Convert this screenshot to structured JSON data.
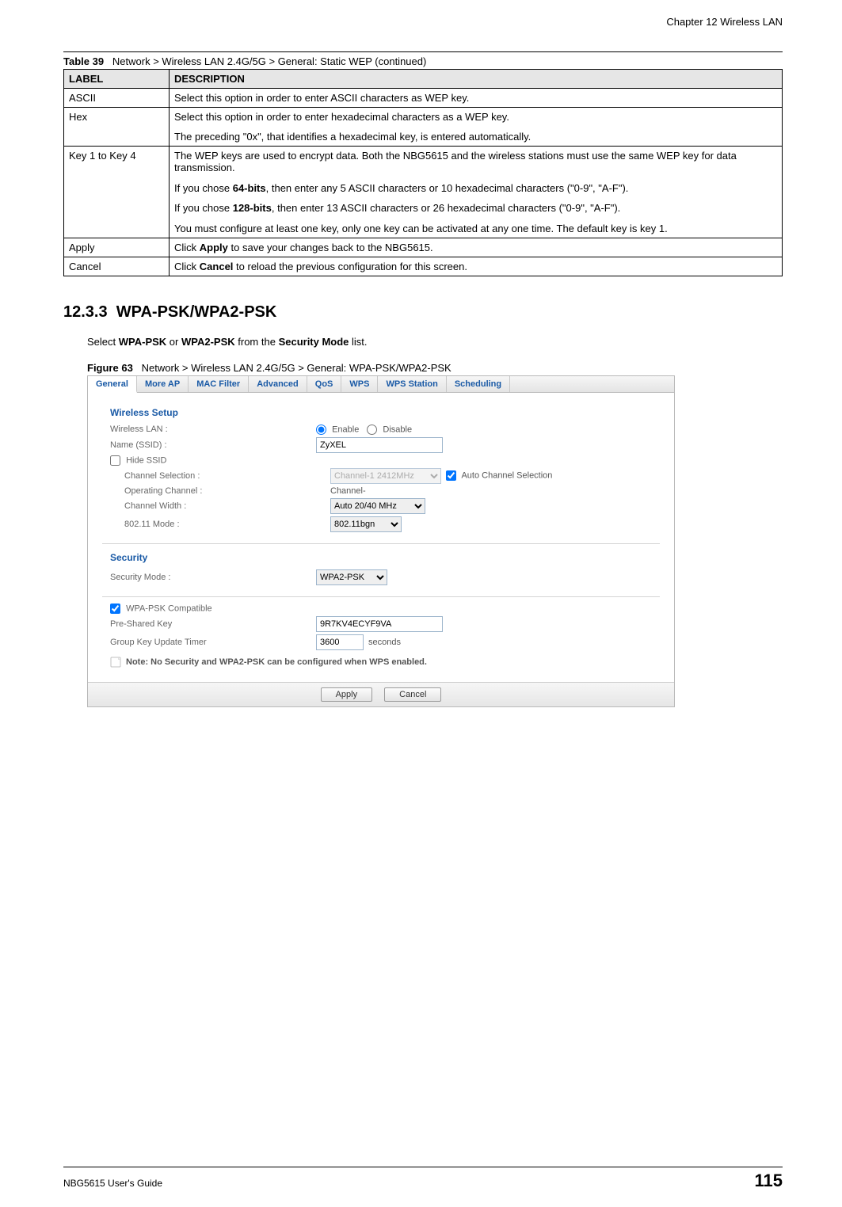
{
  "chapter": "Chapter 12 Wireless LAN",
  "table": {
    "caption_label": "Table 39",
    "caption": "Network > Wireless LAN 2.4G/5G > General: Static WEP (continued)",
    "header_label": "LABEL",
    "header_desc": "DESCRIPTION",
    "rows": [
      {
        "label": "ASCII",
        "desc_parts": [
          "Select this option in order to enter ASCII characters as WEP key."
        ]
      },
      {
        "label": "Hex",
        "desc_parts": [
          "Select this option in order to enter hexadecimal characters as a WEP key.",
          "The preceding \"0x\", that identifies a hexadecimal key, is entered automatically."
        ]
      },
      {
        "label": "Key 1 to Key 4",
        "desc_parts": [
          "The WEP keys are used to encrypt data. Both the NBG5615 and the wireless stations must use the same WEP key for data transmission.",
          "If you chose <b>64-bits</b>, then enter any 5 ASCII characters or 10 hexadecimal characters (\"0-9\", \"A-F\").",
          "If you chose <b>128-bits</b>, then enter 13 ASCII characters or 26 hexadecimal characters (\"0-9\", \"A-F\").",
          "You must configure at least one key, only one key can be activated at any one time. The default key is key 1."
        ]
      },
      {
        "label": "Apply",
        "desc_parts": [
          "Click <b>Apply</b> to save your changes back to the NBG5615."
        ]
      },
      {
        "label": "Cancel",
        "desc_parts": [
          "Click <b>Cancel</b> to reload the previous configuration for this screen."
        ]
      }
    ]
  },
  "section": {
    "number": "12.3.3",
    "title": "WPA-PSK/WPA2-PSK",
    "body_pre": "Select ",
    "body_b1": "WPA-PSK",
    "body_mid": " or ",
    "body_b2": "WPA2-PSK",
    "body_mid2": " from the ",
    "body_b3": "Security Mode",
    "body_post": " list."
  },
  "figure": {
    "caption_label": "Figure 63",
    "caption": "Network > Wireless LAN 2.4G/5G > General: WPA-PSK/WPA2-PSK"
  },
  "ui": {
    "tabs": [
      "General",
      "More AP",
      "MAC Filter",
      "Advanced",
      "QoS",
      "WPS",
      "WPS Station",
      "Scheduling"
    ],
    "wireless_setup_title": "Wireless Setup",
    "labels": {
      "wlan": "Wireless LAN :",
      "enable": "Enable",
      "disable": "Disable",
      "name": "Name (SSID) :",
      "hide": "Hide SSID",
      "channel_sel": "Channel Selection :",
      "auto_channel": "Auto Channel Selection",
      "op_channel": "Operating Channel :",
      "op_channel_val": "Channel-",
      "channel_width": "Channel Width :",
      "mode": "802.11 Mode :",
      "security_title": "Security",
      "security_mode": "Security Mode :",
      "wpa_compat": "WPA-PSK Compatible",
      "psk": "Pre-Shared Key",
      "group_timer": "Group Key Update Timer",
      "seconds": "seconds",
      "note": "Note: No Security and WPA2-PSK can be configured when WPS enabled."
    },
    "values": {
      "ssid": "ZyXEL",
      "channel_option": "Channel-1 2412MHz",
      "width_option": "Auto 20/40 MHz",
      "mode_option": "802.11bgn",
      "security_option": "WPA2-PSK",
      "psk": "9R7KV4ECYF9VA",
      "timer": "3600"
    },
    "buttons": {
      "apply": "Apply",
      "cancel": "Cancel"
    }
  },
  "footer": {
    "guide": "NBG5615 User's Guide",
    "page": "115"
  }
}
